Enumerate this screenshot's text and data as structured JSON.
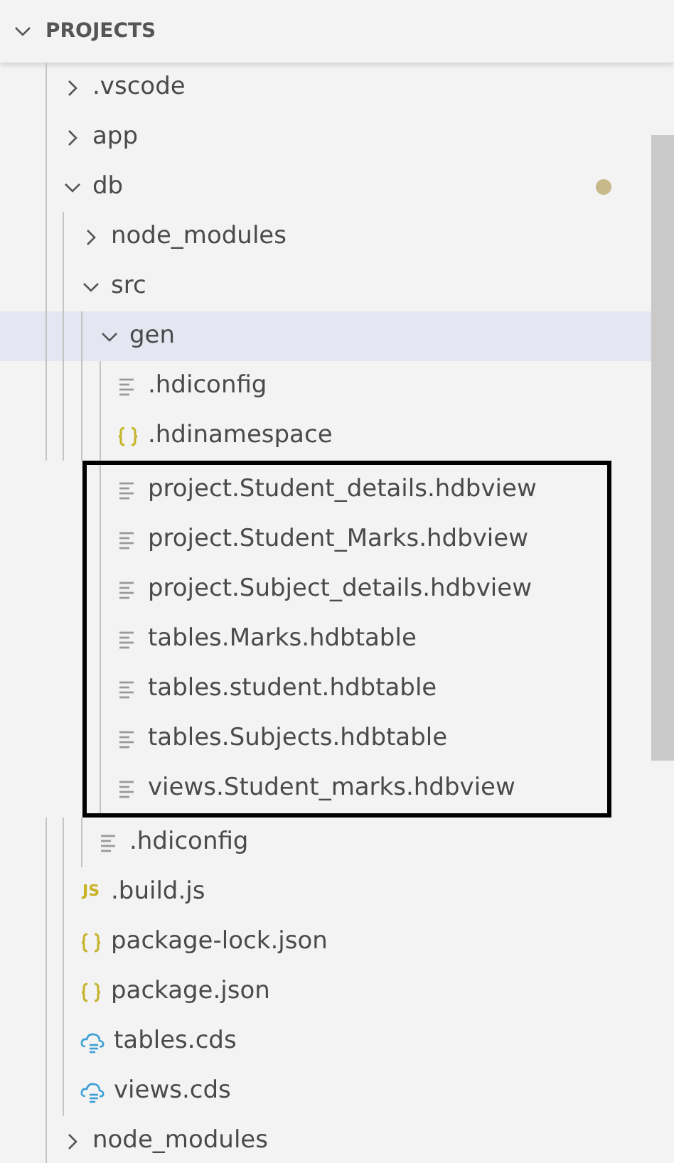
{
  "explorer": {
    "title": "PROJECTS",
    "expanded": true,
    "items": [
      {
        "label": ".vscode",
        "kind": "folder",
        "expanded": false,
        "selected": false
      },
      {
        "label": "app",
        "kind": "folder",
        "expanded": false,
        "selected": false
      },
      {
        "label": "db",
        "kind": "folder",
        "expanded": true,
        "selected": false,
        "modified": true,
        "children": [
          {
            "label": "node_modules",
            "kind": "folder",
            "expanded": false,
            "selected": false
          },
          {
            "label": "src",
            "kind": "folder",
            "expanded": true,
            "selected": false,
            "children": [
              {
                "label": "gen",
                "kind": "folder",
                "expanded": true,
                "selected": true,
                "children": [
                  {
                    "label": ".hdiconfig",
                    "kind": "text",
                    "selected": false,
                    "outlined": false
                  },
                  {
                    "label": ".hdinamespace",
                    "kind": "json",
                    "selected": false,
                    "outlined": false
                  },
                  {
                    "label": "project.Student_details.hdbview",
                    "kind": "text",
                    "selected": false,
                    "outlined": true
                  },
                  {
                    "label": "project.Student_Marks.hdbview",
                    "kind": "text",
                    "selected": false,
                    "outlined": true
                  },
                  {
                    "label": "project.Subject_details.hdbview",
                    "kind": "text",
                    "selected": false,
                    "outlined": true
                  },
                  {
                    "label": "tables.Marks.hdbtable",
                    "kind": "text",
                    "selected": false,
                    "outlined": true
                  },
                  {
                    "label": "tables.student.hdbtable",
                    "kind": "text",
                    "selected": false,
                    "outlined": true
                  },
                  {
                    "label": "tables.Subjects.hdbtable",
                    "kind": "text",
                    "selected": false,
                    "outlined": true
                  },
                  {
                    "label": "views.Student_marks.hdbview",
                    "kind": "text",
                    "selected": false,
                    "outlined": true
                  }
                ]
              },
              {
                "label": ".hdiconfig",
                "kind": "text",
                "selected": false
              }
            ]
          },
          {
            "label": ".build.js",
            "kind": "js",
            "badge": "JS",
            "selected": false
          },
          {
            "label": "package-lock.json",
            "kind": "json",
            "selected": false
          },
          {
            "label": "package.json",
            "kind": "json",
            "selected": false
          },
          {
            "label": "tables.cds",
            "kind": "cds",
            "selected": false
          },
          {
            "label": "views.cds",
            "kind": "cds",
            "selected": false
          }
        ]
      },
      {
        "label": "node_modules",
        "kind": "folder",
        "expanded": false,
        "selected": false
      }
    ]
  }
}
